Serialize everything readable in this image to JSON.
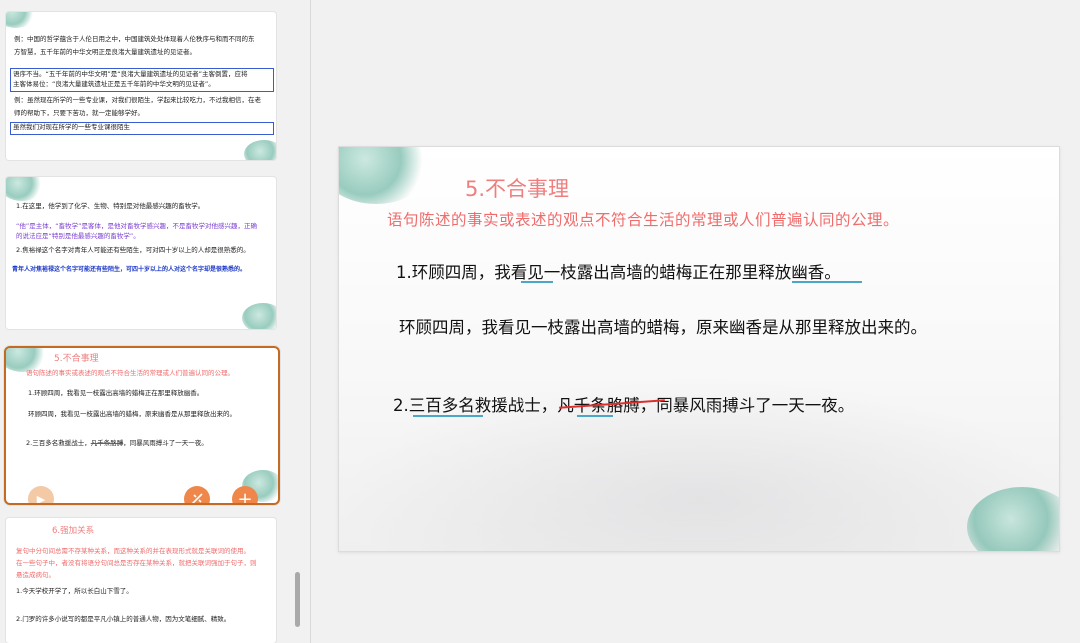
{
  "thumbnails": {
    "t1": {
      "line1": "例：中国的哲学蕴含于人伦日用之中，中国建筑处处体现着人伦秩序与和而不同的东",
      "line2": "方智慧，五千年前的中华文明正是良渚大量建筑遗址的见证者。",
      "box1_line1": "语序不当。“五千年前的中华文明”是“良渚大量建筑遗址的见证者”主客倒置，应将",
      "box1_line2": "主客体易位：“良渚大量建筑遗址正是五千年前的中华文明的见证者”。",
      "line3": "例：虽然现在所学的一些专业课，对我们很陌生，学起来比较吃力，不过我相信，在老",
      "line4": "师的帮助下，只要下苦功，就一定能够学好。",
      "box2": "虽然我们对现在所学的一些专业课很陌生"
    },
    "t2": {
      "line1": "1.在这里，他学到了化学、生物、特别是对他最感兴趣的畜牧学。",
      "purple1": "“他”是主体，“畜牧学”是客体，是他对畜牧学感兴趣，不是畜牧学对他感兴趣，正确",
      "purple2": "的说法应是“特别是他最感兴趣的畜牧学”。",
      "line2": "2.焦裕禄这个名字对青年人可能还有些陌生，可对四十岁以上的人却是很熟悉的。",
      "blue": "青年人对焦裕禄这个名字可能还有些陌生，可四十岁以上的人对这个名字却是很熟悉的。"
    },
    "t3": {
      "title": "5.不合事理",
      "subtitle": "语句陈述的事实或表述的观点不符合生活的常理或人们普遍认同的公理。",
      "line1": "1.环顾四周，我看见一枝露出高墙的蜡梅正在那里释放幽香。",
      "line2": "环顾四周，我看见一枝露出高墙的蜡梅，原来幽香是从那里释放出来的。",
      "line3a": "2.三百多名救援战士，",
      "line3b": "凡千条胳膊",
      "line3c": "，同暴风雨搏斗了一天一夜。"
    },
    "t4": {
      "title": "6.强加关系",
      "sub1": "复句中分句间总需不存某种关系，而这种关系的并在表现形式就是关联词的使用。",
      "sub2": "在一些句子中，者没有将语分句间总是否存在某种关系，就把关联词强加于句子，则",
      "sub3": "悬造成病句。",
      "line1": "1.今天学校开学了，所以长白山下雪了。",
      "line2": "2.门罗的许多小说写的都是平凡小镇上的普通人物，因为文笔细腻、精致。"
    }
  },
  "slide": {
    "title": "5.不合事理",
    "subtitle": "语句陈述的事实或表述的观点不符合生活的常理或人们普遍认同的公理。",
    "line1": "1.环顾四周，我看见一枝露出高墙的蜡梅正在那里释放幽香。",
    "line2": "环顾四周，我看见一枝露出高墙的蜡梅，原来幽香是从那里释放出来的。",
    "line3a": "2.三百多名救援战士，",
    "line3b": "凡千条胳膊",
    "line3c": "，同暴风雨搏斗了一天一夜。"
  },
  "controls": {
    "play_icon": "▶",
    "plus_icon": "+"
  },
  "colors": {
    "accent": "#ef7e7e",
    "selection_border": "#c36b24",
    "control_orange": "#f0874a"
  }
}
